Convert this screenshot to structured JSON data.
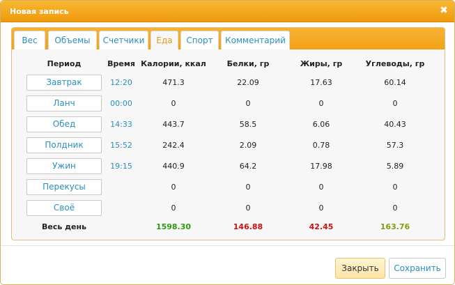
{
  "dialog": {
    "title": "Новая запись",
    "close_glyph": "✖"
  },
  "tabs": [
    {
      "label": "Вес"
    },
    {
      "label": "Объемы"
    },
    {
      "label": "Счетчики"
    },
    {
      "label": "Еда"
    },
    {
      "label": "Спорт"
    },
    {
      "label": "Комментарий"
    }
  ],
  "active_tab": "Еда",
  "columns": {
    "period": "Период",
    "time": "Время",
    "calories": "Калории, ккал",
    "protein": "Белки, гр",
    "fat": "Жиры, гр",
    "carbs": "Углеводы, гр"
  },
  "rows": [
    {
      "period": "Завтрак",
      "time": "12:20",
      "calories": "471.3",
      "protein": "22.09",
      "fat": "17.63",
      "carbs": "60.14"
    },
    {
      "period": "Ланч",
      "time": "00:00",
      "calories": "0",
      "protein": "0",
      "fat": "0",
      "carbs": "0"
    },
    {
      "period": "Обед",
      "time": "14:33",
      "calories": "443.7",
      "protein": "58.5",
      "fat": "6.06",
      "carbs": "40.43"
    },
    {
      "period": "Полдник",
      "time": "15:52",
      "calories": "242.4",
      "protein": "2.09",
      "fat": "0.78",
      "carbs": "57.3"
    },
    {
      "period": "Ужин",
      "time": "19:15",
      "calories": "440.9",
      "protein": "64.2",
      "fat": "17.98",
      "carbs": "5.89"
    },
    {
      "period": "Перекусы",
      "time": "",
      "calories": "0",
      "protein": "0",
      "fat": "0",
      "carbs": "0"
    },
    {
      "period": "Своё",
      "time": "",
      "calories": "0",
      "protein": "0",
      "fat": "0",
      "carbs": "0"
    }
  ],
  "totals": {
    "label": "Весь день",
    "calories": "1598.30",
    "protein": "146.88",
    "fat": "42.45",
    "carbs": "163.76"
  },
  "total_colors": {
    "calories": "#2e9a12",
    "protein": "#cc1111",
    "fat": "#cc1111",
    "carbs": "#8a9a10"
  },
  "footer": {
    "close_label": "Закрыть",
    "save_label": "Сохранить"
  },
  "colors": {
    "accent": "#f5a623",
    "link": "#2a8fbd",
    "active_tab": "#e89a10"
  }
}
